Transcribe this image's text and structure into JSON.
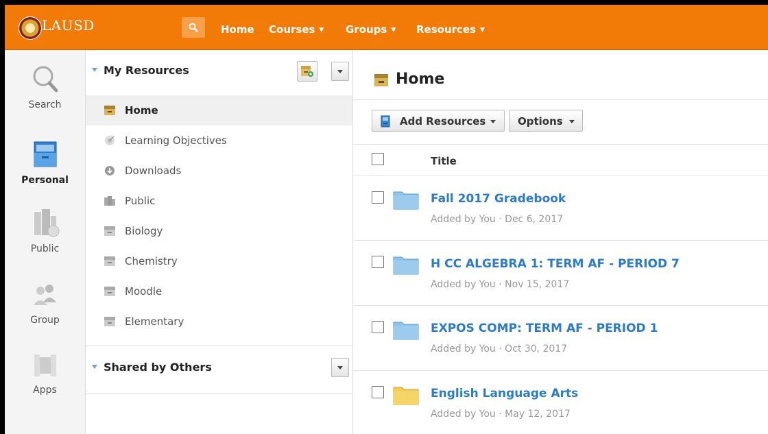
{
  "header": {
    "brand": "LAUSD",
    "nav": [
      {
        "label": "Home",
        "has_menu": false
      },
      {
        "label": "Courses",
        "has_menu": true
      },
      {
        "label": "Groups",
        "has_menu": true
      },
      {
        "label": "Resources",
        "has_menu": true
      }
    ],
    "accent_color": "#f27b07"
  },
  "rail": {
    "items": [
      {
        "label": "Search",
        "icon": "magnifier-icon",
        "active": false
      },
      {
        "label": "Personal",
        "icon": "personal-box-icon",
        "active": true
      },
      {
        "label": "Public",
        "icon": "public-building-icon",
        "active": false
      },
      {
        "label": "Group",
        "icon": "group-people-icon",
        "active": false
      },
      {
        "label": "Apps",
        "icon": "apps-icon",
        "active": false
      }
    ]
  },
  "tree": {
    "my_resources_title": "My Resources",
    "items": [
      {
        "label": "Home",
        "icon": "box-icon",
        "active": true
      },
      {
        "label": "Learning Objectives",
        "icon": "target-icon",
        "active": false
      },
      {
        "label": "Downloads",
        "icon": "download-icon",
        "active": false
      },
      {
        "label": "Public",
        "icon": "building-icon",
        "active": false
      },
      {
        "label": "Biology",
        "icon": "box-icon",
        "active": false
      },
      {
        "label": "Chemistry",
        "icon": "box-icon",
        "active": false
      },
      {
        "label": "Moodle",
        "icon": "box-icon",
        "active": false
      },
      {
        "label": "Elementary",
        "icon": "box-icon",
        "active": false
      }
    ],
    "shared_title": "Shared by Others"
  },
  "main": {
    "title": "Home",
    "add_resources_label": "Add Resources",
    "options_label": "Options",
    "column_title": "Title",
    "rows": [
      {
        "title": "Fall 2017 Gradebook",
        "meta": "Added by You · Dec 6, 2017",
        "folder_color": "#8fc3ea"
      },
      {
        "title": "H CC ALGEBRA 1: TERM AF - PERIOD 7",
        "meta": "Added by You · Nov 15, 2017",
        "folder_color": "#8fc3ea"
      },
      {
        "title": "EXPOS COMP: TERM AF - PERIOD 1",
        "meta": "Added by You · Oct 30, 2017",
        "folder_color": "#8fc3ea"
      },
      {
        "title": "English Language Arts",
        "meta": "Added by You · May 12, 2017",
        "folder_color": "#f5d565"
      }
    ]
  }
}
